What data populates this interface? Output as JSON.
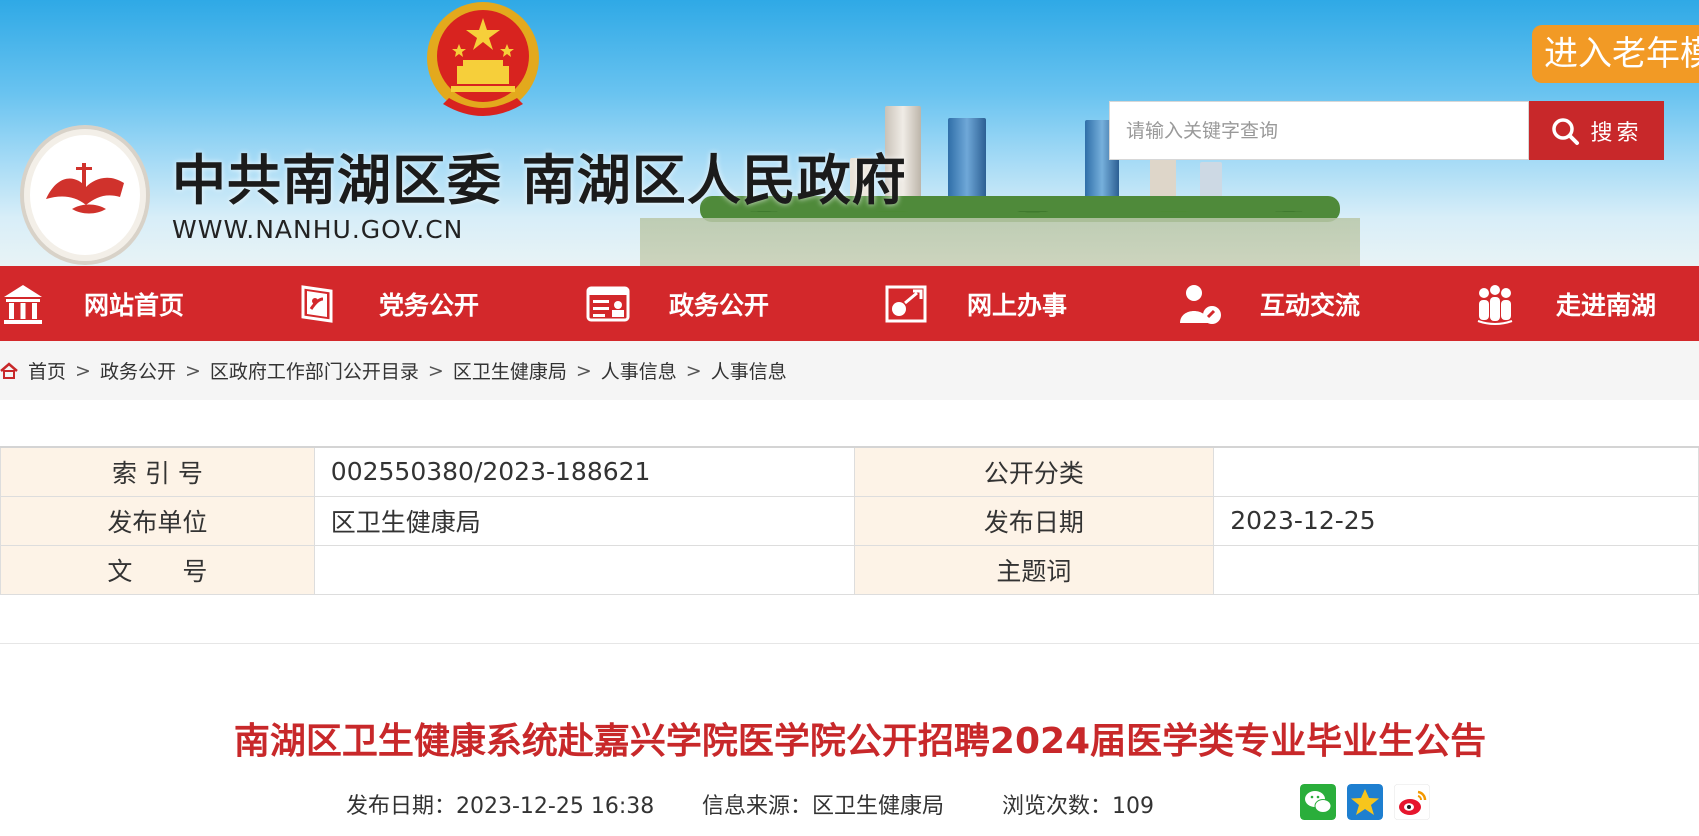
{
  "header": {
    "site_title": "中共南湖区委 南湖区人民政府",
    "site_url": "WWW.NANHU.GOV.CN",
    "elder_mode_label": "进入老年模式",
    "search": {
      "placeholder": "请输入关键字查询",
      "button_label": "搜索"
    }
  },
  "nav": {
    "items": [
      {
        "label": "网站首页",
        "icon": "home-building-icon"
      },
      {
        "label": "党务公开",
        "icon": "party-flag-icon"
      },
      {
        "label": "政务公开",
        "icon": "id-card-icon"
      },
      {
        "label": "网上办事",
        "icon": "online-service-icon"
      },
      {
        "label": "互动交流",
        "icon": "person-chat-icon"
      },
      {
        "label": "走进南湖",
        "icon": "group-people-icon"
      }
    ]
  },
  "breadcrumb": [
    "首页",
    "政务公开",
    "区政府工作部门公开目录",
    "区卫生健康局",
    "人事信息",
    "人事信息"
  ],
  "info_table": {
    "index_label": "索 引 号",
    "index_value": "002550380/2023-188621",
    "category_label": "公开分类",
    "category_value": "",
    "publisher_label": "发布单位",
    "publisher_value": "区卫生健康局",
    "date_label": "发布日期",
    "date_value": "2023-12-25",
    "docno_label": "文　　号",
    "docno_value": "",
    "keywords_label": "主题词",
    "keywords_value": ""
  },
  "article": {
    "title": "南湖区卫生健康系统赴嘉兴学院医学院公开招聘2024届医学类专业毕业生公告",
    "publish_date": "发布日期：2023-12-25 16:38",
    "source": "信息来源：区卫生健康局",
    "views": "浏览次数：109"
  },
  "share": [
    "wechat-icon",
    "favorite-star-icon",
    "weibo-icon"
  ],
  "colors": {
    "brand_red": "#d3282b",
    "title_red": "#c8282a",
    "elder_orange": "#f29a25",
    "key_bg": "#fdf3e7"
  }
}
